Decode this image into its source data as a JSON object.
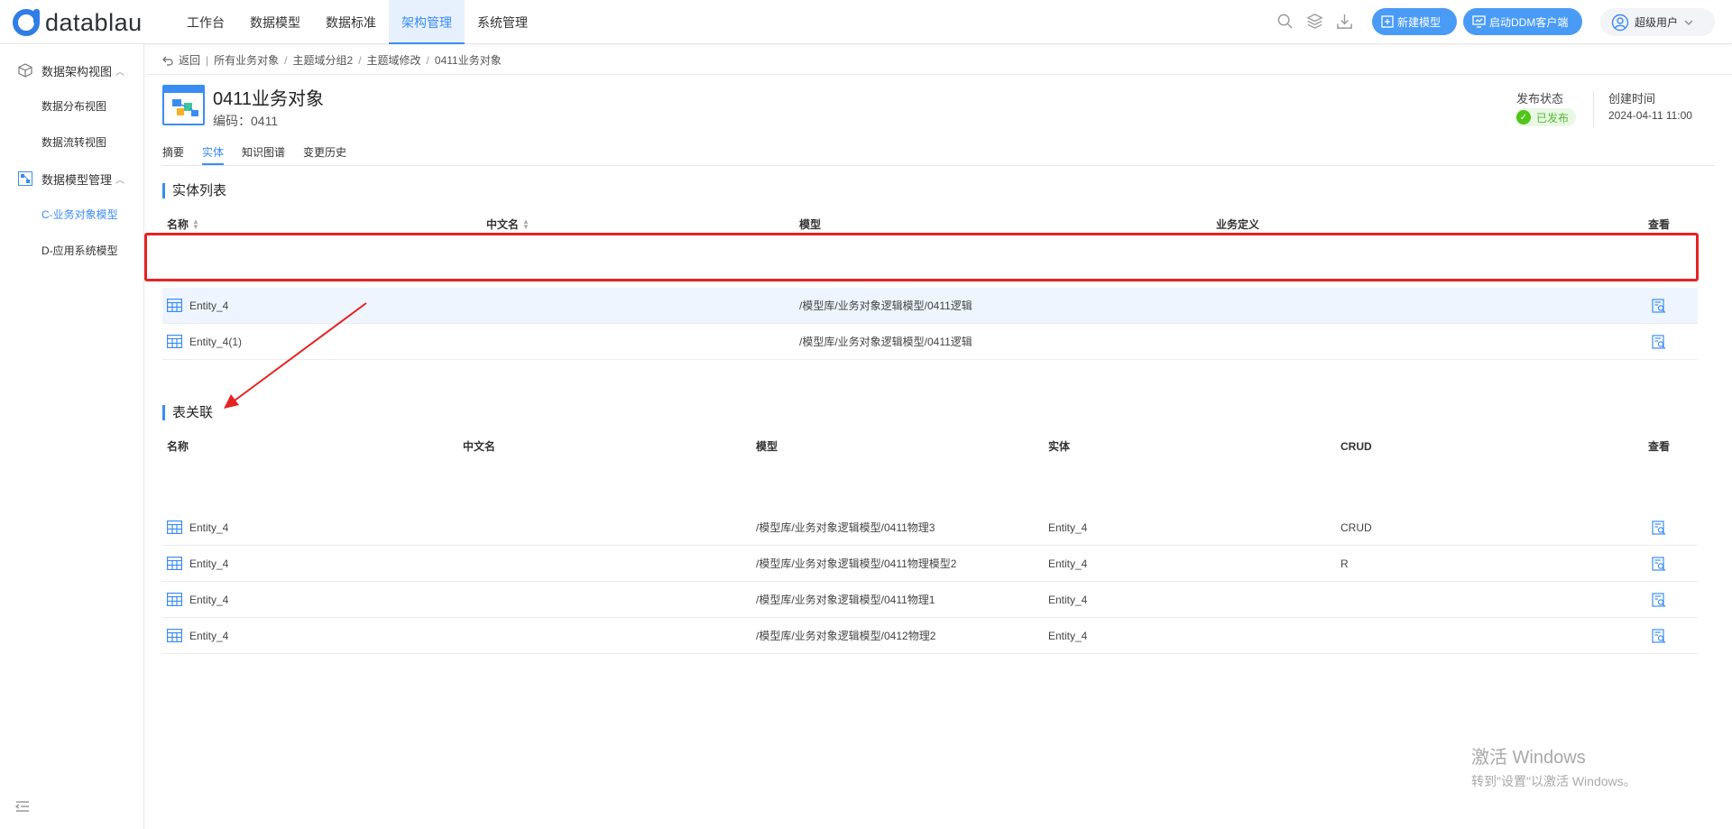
{
  "app": {
    "logo_text": "datablau"
  },
  "nav": {
    "items": [
      "工作台",
      "数据模型",
      "数据标准",
      "架构管理",
      "系统管理"
    ],
    "active": "架构管理"
  },
  "header": {
    "new_model": "新建模型",
    "launch_ddm": "启动DDM客户端",
    "user": "超级用户"
  },
  "sidebar": {
    "group1": "数据架构视图",
    "items1": [
      "数据分布视图",
      "数据流转视图"
    ],
    "group2": "数据模型管理",
    "items2": [
      "C-业务对象模型",
      "D-应用系统模型"
    ],
    "active": "C-业务对象模型"
  },
  "breadcrumb": {
    "back": "返回",
    "items": [
      "所有业务对象",
      "主题域分组2",
      "主题域修改",
      "0411业务对象"
    ]
  },
  "object": {
    "title": "0411业务对象",
    "code": "编码：0411",
    "publish_label": "发布状态",
    "publish_value": "已发布",
    "create_label": "创建时间",
    "create_time": "2024-04-11 11:00"
  },
  "tabs": [
    "摘要",
    "实体",
    "知识图谱",
    "变更历史"
  ],
  "active_tab": "实体",
  "entity_section": {
    "title": "实体列表",
    "headers": {
      "name": "名称",
      "cn": "中文名",
      "model": "模型",
      "def": "业务定义",
      "view": "查看"
    },
    "rows": [
      {
        "name": "Entity_4",
        "cn": "",
        "model": "/模型库/业务对象逻辑模型/0411逻辑",
        "def": ""
      },
      {
        "name": "Entity_4(1)",
        "cn": "",
        "model": "/模型库/业务对象逻辑模型/0411逻辑",
        "def": ""
      }
    ]
  },
  "relation_section": {
    "title": "表关联",
    "headers": {
      "name": "名称",
      "cn": "中文名",
      "model": "模型",
      "entity": "实体",
      "crud": "CRUD",
      "view": "查看"
    },
    "rows": [
      {
        "name": "Entity_4",
        "cn": "",
        "model": "/模型库/业务对象逻辑模型/0411物理3",
        "entity": "Entity_4",
        "crud": "CRUD"
      },
      {
        "name": "Entity_4",
        "cn": "",
        "model": "/模型库/业务对象逻辑模型/0411物理模型2",
        "entity": "Entity_4",
        "crud": "R"
      },
      {
        "name": "Entity_4",
        "cn": "",
        "model": "/模型库/业务对象逻辑模型/0411物理1",
        "entity": "Entity_4",
        "crud": ""
      },
      {
        "name": "Entity_4",
        "cn": "",
        "model": "/模型库/业务对象逻辑模型/0412物理2",
        "entity": "Entity_4",
        "crud": ""
      }
    ]
  },
  "watermark": {
    "line1": "激活 Windows",
    "line2": "转到\"设置\"以激活 Windows。"
  },
  "colors": {
    "accent": "#3b8cf2",
    "highlight": "#e62222",
    "published": "#52c41a"
  }
}
